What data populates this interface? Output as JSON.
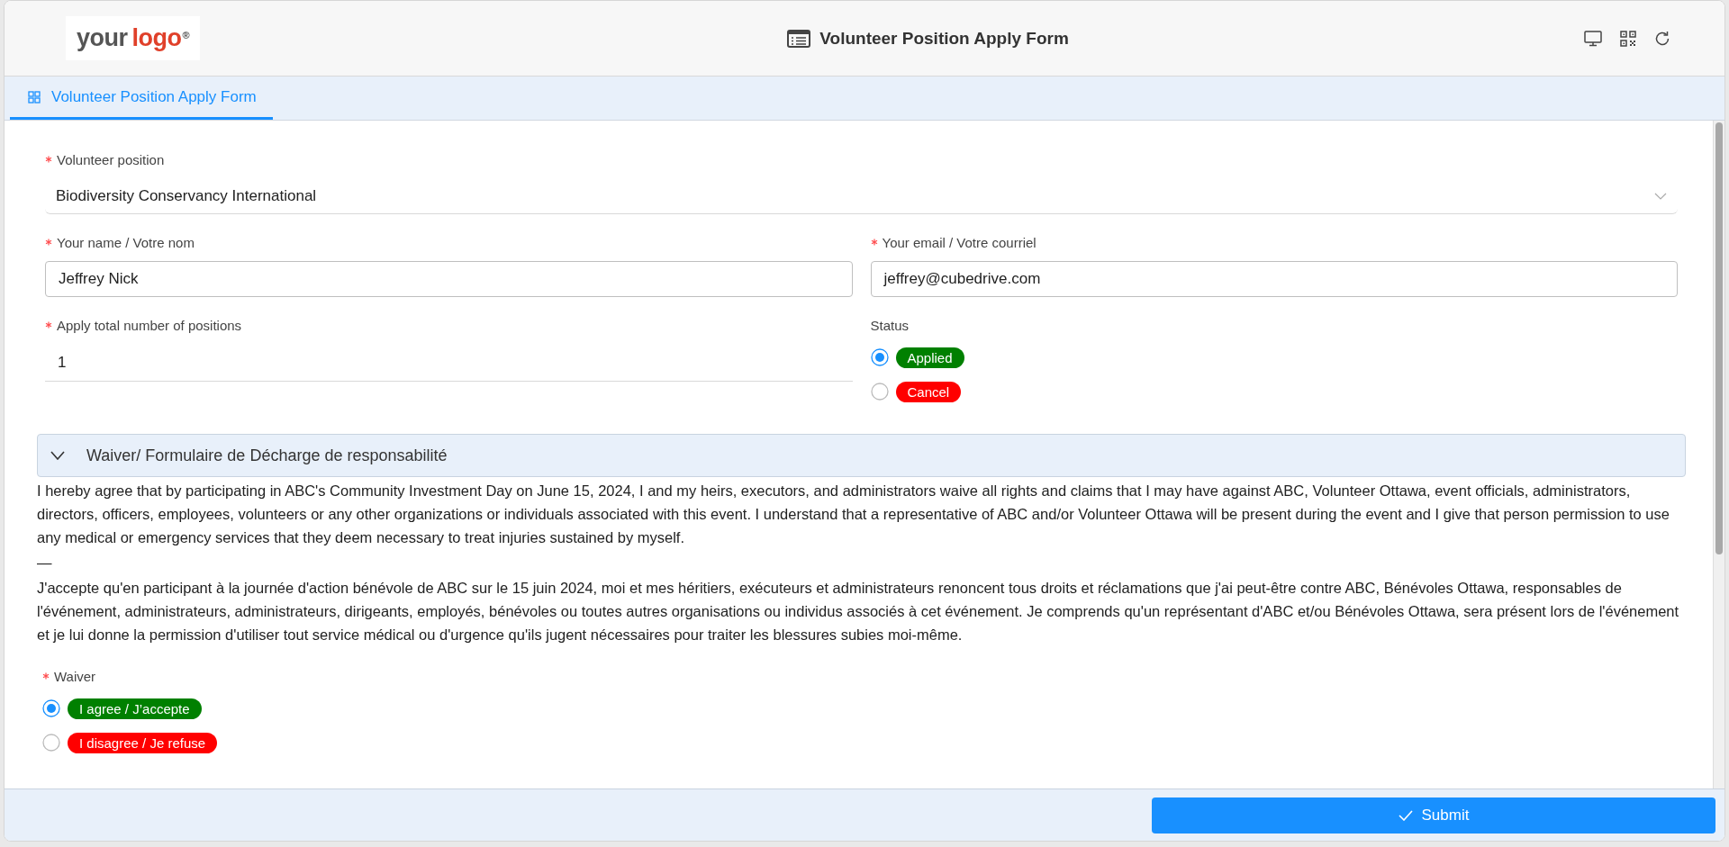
{
  "header": {
    "logo": {
      "word_1": "your",
      "word_2": "logo",
      "mark": "®"
    },
    "title": "Volunteer Position Apply Form"
  },
  "tabs": [
    {
      "label": "Volunteer Position Apply Form",
      "selected": true
    }
  ],
  "rows": [
    [
      {
        "kind": "select",
        "label": "Volunteer position",
        "required": true,
        "value": "Biodiversity Conservancy International"
      }
    ],
    [
      {
        "kind": "text",
        "label": "Your name / Votre nom",
        "required": true,
        "value": "Jeffrey Nick"
      },
      {
        "kind": "text",
        "label": "Your email / Votre courriel",
        "required": true,
        "value": "jeffrey@cubedrive.com"
      }
    ],
    [
      {
        "kind": "number",
        "label": "Apply total number of positions",
        "required": true,
        "value": "1"
      },
      {
        "kind": "radio",
        "label": "Status",
        "required": false,
        "options": [
          {
            "label": "Applied",
            "selected": true,
            "color": "#008000"
          },
          {
            "label": "Cancel",
            "selected": false,
            "color": "#ff0000"
          }
        ]
      }
    ]
  ],
  "waiver_section": {
    "title": "Waiver/ Formulaire de Décharge de responsabilité",
    "expanded": true,
    "paragraphs": [
      "I hereby agree that by participating in ABC's Community Investment Day on June 15, 2024, I and my heirs, executors, and administrators waive all rights and claims that I may have against ABC, Volunteer Ottawa, event officials, administrators, directors, officers, employees, volunteers or any other organizations or individuals associated with this event. I understand that a representative of ABC and/or Volunteer Ottawa will be present during the event and I give that person permission to use any medical or emergency services that they deem necessary to treat injuries sustained by myself.",
      "—",
      "J'accepte qu'en participant à la journée d'action bénévole de ABC sur le 15 juin 2024, moi et mes héritiers, exécuteurs et administrateurs renoncent tous droits et réclamations que j'ai peut-être contre ABC, Bénévoles Ottawa, responsables de l'événement, administrateurs, administrateurs, dirigeants, employés, bénévoles ou toutes autres organisations ou individus associés à cet événement. Je comprends qu'un représentant d'ABC et/ou Bénévoles Ottawa, sera présent lors de l'événement et je lui donne la permission d'utiliser tout service médical ou d'urgence qu'ils jugent nécessaires pour traiter les blessures subies moi-même."
    ]
  },
  "waiver": {
    "kind": "radio",
    "label": "Waiver",
    "required": true,
    "options": [
      {
        "label": "I agree / J’accepte",
        "selected": true,
        "color": "#008000"
      },
      {
        "label": "I disagree / Je refuse",
        "selected": false,
        "color": "#ff0000"
      }
    ]
  },
  "submit": {
    "label": "Submit"
  }
}
